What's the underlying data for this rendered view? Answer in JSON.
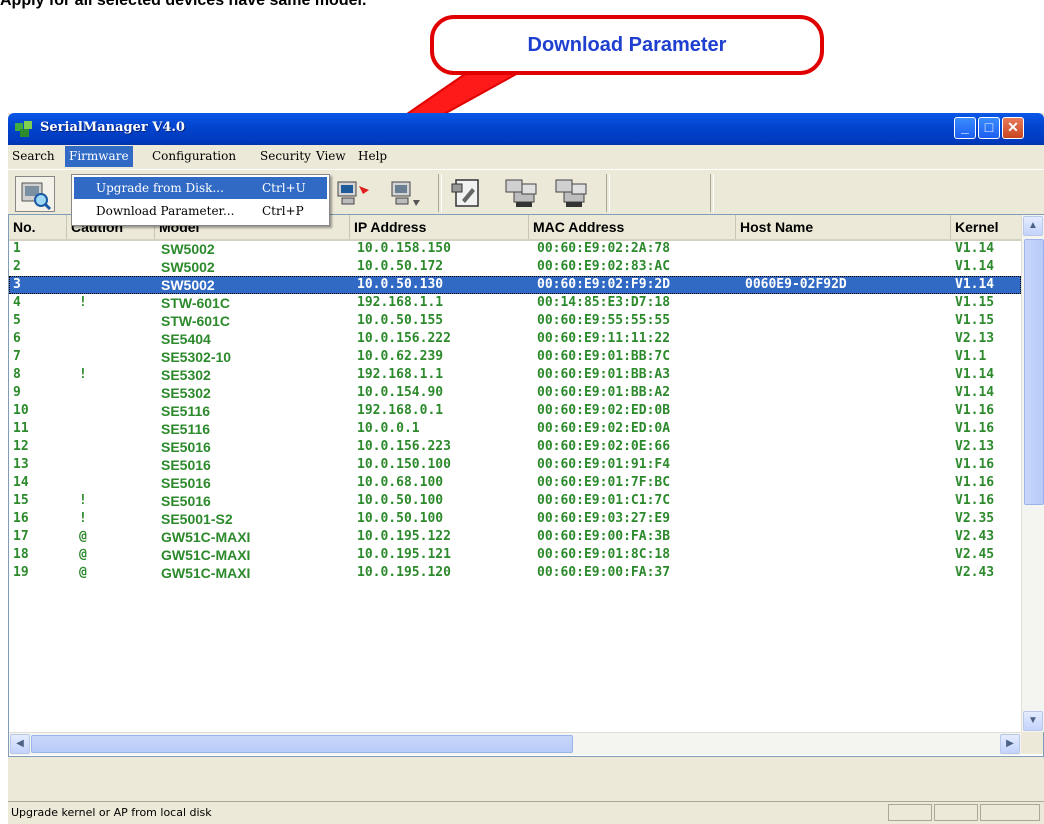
{
  "document": {
    "heading": "Apply for all selected devices have same model."
  },
  "callout": {
    "label": "Download Parameter"
  },
  "window": {
    "title": "SerialManager V4.0",
    "controls": {
      "minimize": "_",
      "maximize": "□",
      "close": "✕"
    }
  },
  "menubar": {
    "items": [
      {
        "label": "Search"
      },
      {
        "label": "Firmware"
      },
      {
        "label": "Configuration"
      },
      {
        "label": "Security"
      },
      {
        "label": "View"
      },
      {
        "label": "Help"
      }
    ]
  },
  "dropdown": {
    "items": [
      {
        "label": "Upgrade from Disk...",
        "shortcut": "Ctrl+U"
      },
      {
        "label": "Download Parameter...",
        "shortcut": "Ctrl+P"
      }
    ]
  },
  "toolbar": {
    "buttons": [
      {
        "icon": "search-device-icon"
      },
      {
        "icon": "computer-reset-icon"
      },
      {
        "icon": "computer-download-icon"
      },
      {
        "icon": "configuration-icon"
      },
      {
        "icon": "network-device-icon"
      },
      {
        "icon": "network-device-2-icon"
      }
    ]
  },
  "table": {
    "columns": [
      "No.",
      "Caution",
      "Model",
      "IP Address",
      "MAC Address",
      "Host Name",
      "Kernel"
    ],
    "selected_row": 3,
    "rows": [
      [
        "1",
        "",
        "SW5002",
        "10.0.158.150",
        "00:60:E9:02:2A:78",
        "",
        "V1.14"
      ],
      [
        "2",
        "",
        "SW5002",
        "10.0.50.172",
        "00:60:E9:02:83:AC",
        "",
        "V1.14"
      ],
      [
        "3",
        "",
        "SW5002",
        "10.0.50.130",
        "00:60:E9:02:F9:2D",
        "0060E9-02F92D",
        "V1.14"
      ],
      [
        "4",
        "!",
        "STW-601C",
        "192.168.1.1",
        "00:14:85:E3:D7:18",
        "",
        "V1.15"
      ],
      [
        "5",
        "",
        "STW-601C",
        "10.0.50.155",
        "00:60:E9:55:55:55",
        "",
        "V1.15"
      ],
      [
        "6",
        "",
        "SE5404",
        "10.0.156.222",
        "00:60:E9:11:11:22",
        "",
        "V2.13"
      ],
      [
        "7",
        "",
        "SE5302-10",
        "10.0.62.239",
        "00:60:E9:01:BB:7C",
        "",
        "V1.1"
      ],
      [
        "8",
        "!",
        "SE5302",
        "192.168.1.1",
        "00:60:E9:01:BB:A3",
        "",
        "V1.14"
      ],
      [
        "9",
        "",
        "SE5302",
        "10.0.154.90",
        "00:60:E9:01:BB:A2",
        "",
        "V1.14"
      ],
      [
        "10",
        "",
        "SE5116",
        "192.168.0.1",
        "00:60:E9:02:ED:0B",
        "",
        "V1.16"
      ],
      [
        "11",
        "",
        "SE5116",
        "10.0.0.1",
        "00:60:E9:02:ED:0A",
        "",
        "V1.16"
      ],
      [
        "12",
        "",
        "SE5016",
        "10.0.156.223",
        "00:60:E9:02:0E:66",
        "",
        "V2.13"
      ],
      [
        "13",
        "",
        "SE5016",
        "10.0.150.100",
        "00:60:E9:01:91:F4",
        "",
        "V1.16"
      ],
      [
        "14",
        "",
        "SE5016",
        "10.0.68.100",
        "00:60:E9:01:7F:BC",
        "",
        "V1.16"
      ],
      [
        "15",
        "!",
        "SE5016",
        "10.0.50.100",
        "00:60:E9:01:C1:7C",
        "",
        "V1.16"
      ],
      [
        "16",
        "!",
        "SE5001-S2",
        "10.0.50.100",
        "00:60:E9:03:27:E9",
        "",
        "V2.35"
      ],
      [
        "17",
        "@",
        "GW51C-MAXI",
        "10.0.195.122",
        "00:60:E9:00:FA:3B",
        "",
        "V2.43"
      ],
      [
        "18",
        "@",
        "GW51C-MAXI",
        "10.0.195.121",
        "00:60:E9:01:8C:18",
        "",
        "V2.45"
      ],
      [
        "19",
        "@",
        "GW51C-MAXI",
        "10.0.195.120",
        "00:60:E9:00:FA:37",
        "",
        "V2.43"
      ]
    ]
  },
  "statusbar": {
    "text": "Upgrade kernel or AP from local disk"
  },
  "colors": {
    "row_text": "#2c8a2c",
    "selection": "#316ac5",
    "title_bar": "#0345cf",
    "callout_border": "#e00000",
    "callout_text": "#1e3fcf"
  }
}
